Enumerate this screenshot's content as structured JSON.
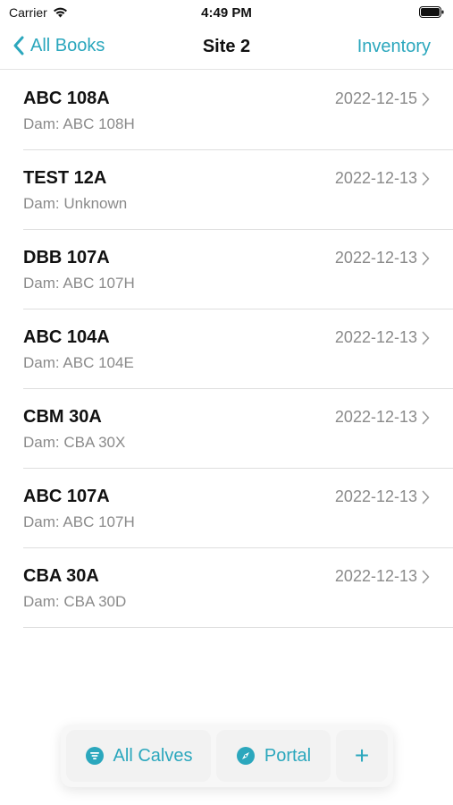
{
  "status_bar": {
    "carrier": "Carrier",
    "time": "4:49 PM"
  },
  "nav": {
    "back_label": "All Books",
    "title": "Site 2",
    "right_label": "Inventory"
  },
  "rows": [
    {
      "title": "ABC 108A",
      "subtitle": "Dam: ABC 108H",
      "date": "2022-12-15"
    },
    {
      "title": "TEST 12A",
      "subtitle": "Dam: Unknown",
      "date": "2022-12-13"
    },
    {
      "title": "DBB 107A",
      "subtitle": "Dam: ABC 107H",
      "date": "2022-12-13"
    },
    {
      "title": "ABC 104A",
      "subtitle": "Dam: ABC 104E",
      "date": "2022-12-13"
    },
    {
      "title": "CBM 30A",
      "subtitle": "Dam: CBA 30X",
      "date": "2022-12-13"
    },
    {
      "title": "ABC 107A",
      "subtitle": "Dam: ABC 107H",
      "date": "2022-12-13"
    },
    {
      "title": "CBA 30A",
      "subtitle": "Dam: CBA 30D",
      "date": "2022-12-13"
    }
  ],
  "toolbar": {
    "all_calves_label": "All Calves",
    "portal_label": "Portal",
    "add_label": "+"
  },
  "icons": {
    "back": "chevron-left-icon",
    "row": "chevron-right-icon",
    "calves": "list-circle-icon",
    "portal": "compass-icon",
    "wifi": "wifi-icon",
    "battery": "battery-icon"
  },
  "colors": {
    "accent": "#2ba7bd",
    "secondary_text": "#8a8a8a",
    "divider": "#dedede"
  }
}
